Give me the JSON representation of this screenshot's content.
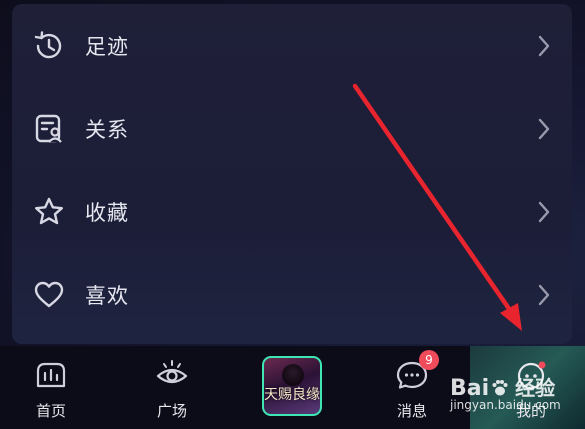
{
  "menu": {
    "items": [
      {
        "label": "足迹",
        "icon": "history-icon"
      },
      {
        "label": "关系",
        "icon": "contact-card-icon"
      },
      {
        "label": "收藏",
        "icon": "star-icon"
      },
      {
        "label": "喜欢",
        "icon": "heart-icon"
      }
    ]
  },
  "tabbar": {
    "home_label": "首页",
    "square_label": "广场",
    "album_text": "天赐良缘",
    "messages_label": "消息",
    "messages_badge": "9",
    "mine_label": "我的"
  },
  "watermark": {
    "brand": "Bai",
    "brand_suffix": "经验",
    "url": "jingyan.baidu.com"
  },
  "colors": {
    "accent_green": "#3ee6b3",
    "badge_red": "#f04b5a",
    "arrow_red": "#e8242e"
  }
}
